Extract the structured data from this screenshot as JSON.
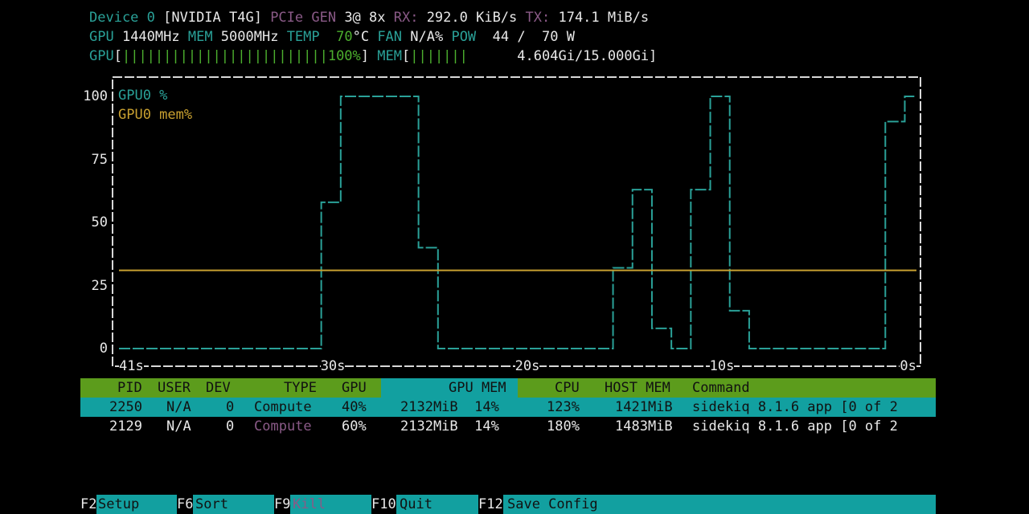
{
  "header": {
    "line1": [
      {
        "t": "Device 0 ",
        "c": "lbl"
      },
      {
        "t": "[NVIDIA T4G] ",
        "c": "val"
      },
      {
        "t": "PCIe GEN ",
        "c": "lblp"
      },
      {
        "t": "3@ 8x ",
        "c": "val"
      },
      {
        "t": "RX: ",
        "c": "lblp"
      },
      {
        "t": "292.0 KiB/s ",
        "c": "val"
      },
      {
        "t": "TX: ",
        "c": "lblp"
      },
      {
        "t": "174.1 MiB/s",
        "c": "val"
      }
    ],
    "line2": [
      {
        "t": "GPU ",
        "c": "lbl"
      },
      {
        "t": "1440MHz ",
        "c": "val"
      },
      {
        "t": "MEM ",
        "c": "lbl"
      },
      {
        "t": "5000MHz ",
        "c": "val"
      },
      {
        "t": "TEMP  ",
        "c": "lbl"
      },
      {
        "t": "70",
        "c": "grn"
      },
      {
        "t": "°C ",
        "c": "val"
      },
      {
        "t": "FAN ",
        "c": "lbl"
      },
      {
        "t": "N/A% ",
        "c": "val"
      },
      {
        "t": "POW ",
        "c": "lbl"
      },
      {
        "t": " 44 /  70 W",
        "c": "val"
      }
    ],
    "line3": [
      {
        "t": "GPU",
        "c": "lbl"
      },
      {
        "t": "[",
        "c": "val"
      },
      {
        "t": "|||||||||||||||||||||||||100%",
        "c": "grn"
      },
      {
        "t": "] ",
        "c": "val"
      },
      {
        "t": "MEM",
        "c": "lbl"
      },
      {
        "t": "[",
        "c": "val"
      },
      {
        "t": "|||||||",
        "c": "grn"
      },
      {
        "t": "      4.604Gi/15.000Gi]",
        "c": "val"
      }
    ]
  },
  "chart_data": {
    "type": "line",
    "legend_placement": "top-left",
    "ylim": [
      0,
      100
    ],
    "yticks": [
      "100",
      "75",
      "50",
      "25",
      "0"
    ],
    "xlim": [
      -41,
      0
    ],
    "xticks": [
      "41s",
      "30s",
      "20s",
      "10s",
      "0s"
    ],
    "grid": false,
    "series": [
      {
        "name": "GPU0 %",
        "color": "#2aa198",
        "x": [
          -41,
          -30.6,
          -29.6,
          -25.6,
          -24.6,
          -15.6,
          -14.6,
          -13.6,
          -12.6,
          -11.6,
          -10.6,
          -9.6,
          -8.6,
          -7.6,
          -6.6,
          -1.6,
          -0.6,
          0
        ],
        "y": [
          0,
          58,
          100,
          40,
          0,
          32,
          63,
          8,
          0,
          63,
          100,
          15,
          0,
          0,
          0,
          90,
          100,
          100
        ]
      },
      {
        "name": "GPU0 mem%",
        "color": "#c8a030",
        "x": [
          -41,
          0
        ],
        "y": [
          31,
          31
        ]
      }
    ]
  },
  "table": {
    "headers": {
      "pid": "PID",
      "user": "USER",
      "dev": "DEV",
      "type": "TYPE",
      "gpu": "GPU",
      "gpumem": "GPU MEM",
      "cpu": "CPU",
      "hostmem": "HOST MEM",
      "command": "Command"
    },
    "rows": [
      {
        "pid": "2250",
        "user": "N/A",
        "dev": "0",
        "type": "Compute",
        "gpu": "40%",
        "gpumem": "2132MiB  14%",
        "cpu": "123%",
        "hostmem": "1421MiB",
        "command": "sidekiq 8.1.6 app [0 of 2",
        "selected": true
      },
      {
        "pid": "2129",
        "user": "N/A",
        "dev": "0",
        "type": "Compute",
        "gpu": "60%",
        "gpumem": "2132MiB  14%",
        "cpu": "180%",
        "hostmem": "1483MiB",
        "command": "sidekiq 8.1.6 app [0 of 2",
        "selected": false
      }
    ]
  },
  "footer": [
    {
      "key": "F2",
      "label": "Setup"
    },
    {
      "key": "F6",
      "label": "Sort"
    },
    {
      "key": "F9",
      "label": "Kill"
    },
    {
      "key": "F10",
      "label": "Quit"
    },
    {
      "key": "F12",
      "label": "Save Config"
    }
  ],
  "colors": {
    "teal": "#2aa198",
    "green_header": "#5c9c1c",
    "selected_row": "#12a0a0",
    "mem_line": "#c8a030",
    "purple_label": "#8a5a87"
  }
}
